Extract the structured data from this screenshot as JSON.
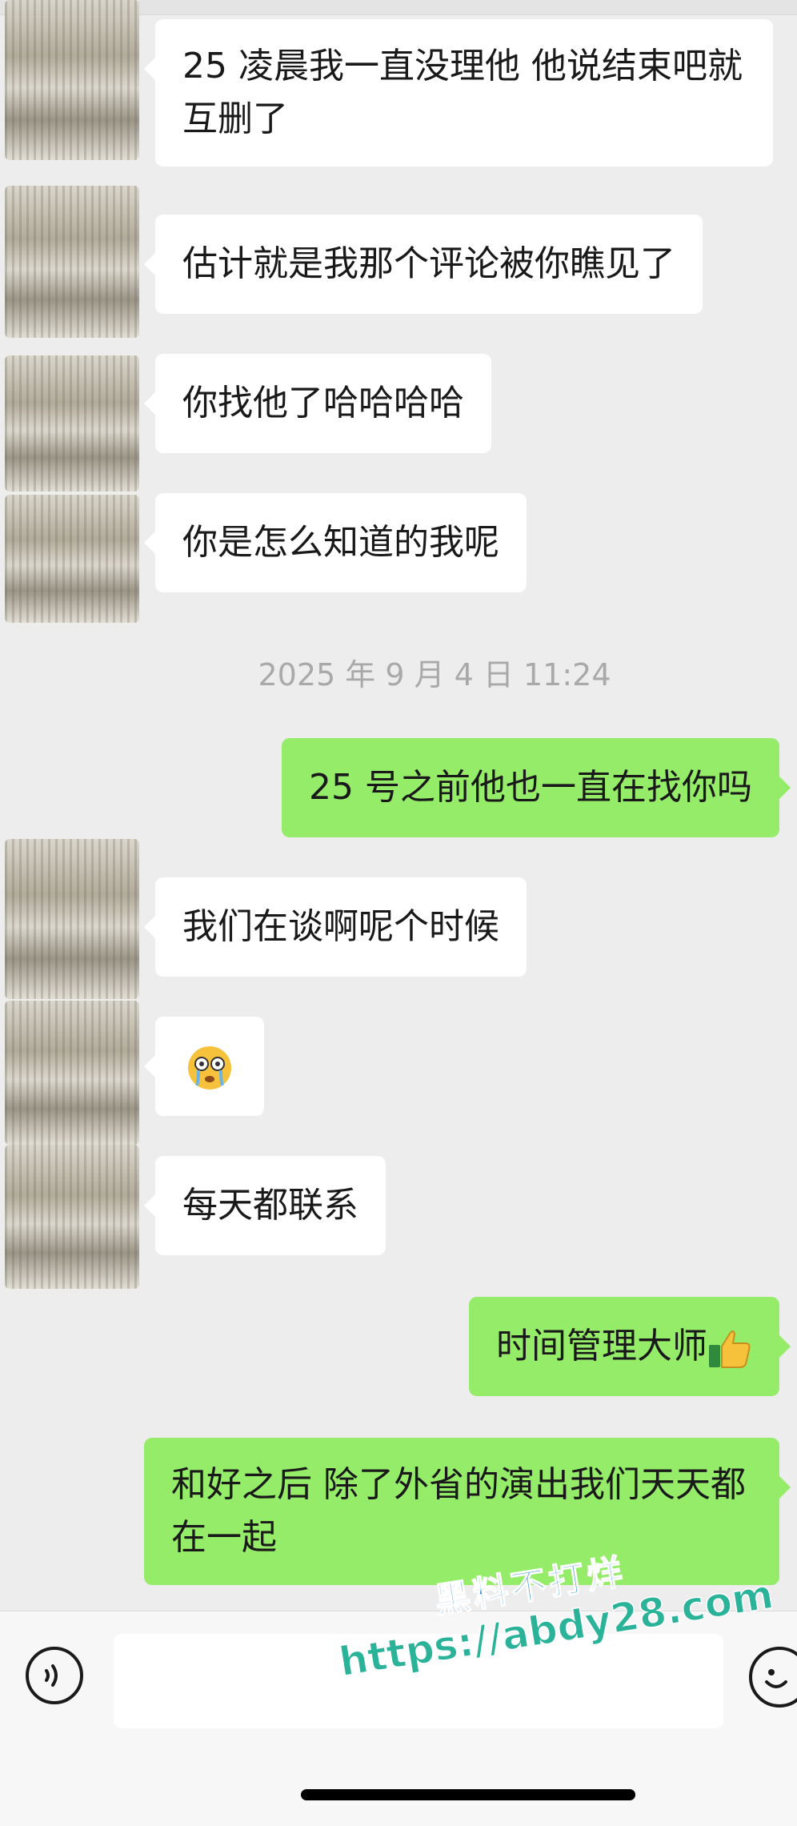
{
  "messages": [
    {
      "side": "in",
      "text": "25 凌晨我一直没理他  他说结束吧就互删了"
    },
    {
      "side": "in",
      "text": "估计就是我那个评论被你瞧见了"
    },
    {
      "side": "in",
      "text": "你找他了哈哈哈哈"
    },
    {
      "side": "in",
      "text": "你是怎么知道的我呢"
    },
    {
      "side": "out",
      "text": "25 号之前他也一直在找你吗"
    },
    {
      "side": "in",
      "text": "我们在谈啊呢个时候"
    },
    {
      "side": "in",
      "text": "",
      "emoji": "crying-face-emoji"
    },
    {
      "side": "in",
      "text": "每天都联系"
    },
    {
      "side": "out",
      "text": "时间管理大师",
      "emoji": "thumbs-up-emoji"
    },
    {
      "side": "out",
      "text": "和好之后 除了外省的演出我们天天都在一起"
    }
  ],
  "timestamp": "2025 年 9 月 4 日 11:24",
  "input": {
    "value": "",
    "placeholder": ""
  },
  "icons": {
    "voice": "voice-icon",
    "emoji": "smiley-icon"
  },
  "watermark": {
    "line1": "黑料不打烊",
    "line2": "https://abdy28.com"
  },
  "colors": {
    "background": "#ededed",
    "incoming_bubble": "#ffffff",
    "outgoing_bubble": "#95ec69",
    "timestamp": "#a9a9a9",
    "watermark_blue": "#2f8ecf",
    "watermark_green": "#2bb39a"
  }
}
